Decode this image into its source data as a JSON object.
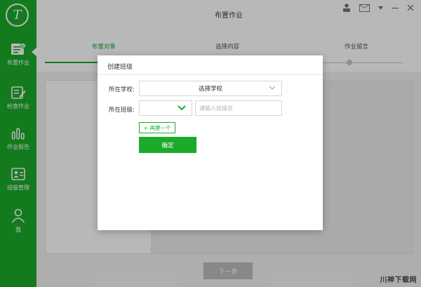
{
  "header": {
    "title": "布置作业"
  },
  "sidebar": {
    "logo_text": "T",
    "items": [
      {
        "label": "布置作业",
        "icon": "assign-homework-icon"
      },
      {
        "label": "检查作业",
        "icon": "check-homework-icon"
      },
      {
        "label": "作业报告",
        "icon": "report-chart-icon"
      },
      {
        "label": "班级管理",
        "icon": "class-management-icon"
      },
      {
        "label": "我",
        "icon": "user-profile-icon"
      }
    ]
  },
  "steps": [
    {
      "label": "布置对象"
    },
    {
      "label": "选择内容"
    },
    {
      "label": "作业留言"
    }
  ],
  "footer": {
    "next_label": "下一步"
  },
  "dialog": {
    "title": "创建班级",
    "school_label": "所在学校:",
    "school_value": "选择学校",
    "class_label": "所在班级:",
    "class_value": "",
    "class_name_placeholder": "请输入班级名",
    "add_label": "+ 再建一个",
    "confirm_label": "确定"
  },
  "watermark": "川神下载网",
  "colors": {
    "brand": "#1bab2a",
    "disabled": "#bdbdbd"
  }
}
